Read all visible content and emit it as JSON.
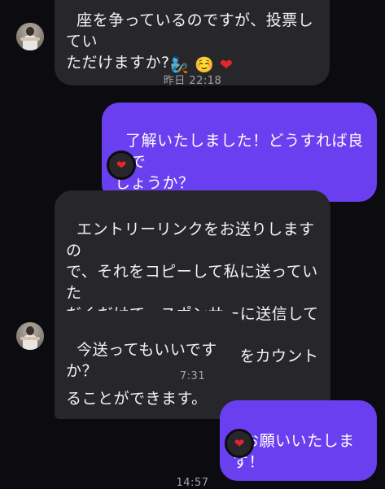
{
  "messages": [
    {
      "id": "m1",
      "type": "incoming",
      "text": "座を争っているのですが、投票してい\nただけますか?",
      "emoji": "🧞 ☺️ ",
      "heart": "❤"
    },
    {
      "id": "ts1",
      "type": "timestamp",
      "text": "昨日 22:18"
    },
    {
      "id": "m2",
      "type": "outgoing",
      "text": "了解いたしました！どうすれば良いで\nしょうか？",
      "reaction": "❤"
    },
    {
      "id": "m3",
      "type": "incoming",
      "text": "エントリーリンクをお送りしますの\nで、それをコピーして私に送っていた\nだくだけで、スポンサーに送信して私\nに代わってあなたの投票をカウントす\nることができます。"
    },
    {
      "id": "m4",
      "type": "incoming",
      "text": "今送ってもいいですか？"
    },
    {
      "id": "ts2",
      "type": "timestamp",
      "text": "7:31"
    },
    {
      "id": "m5",
      "type": "outgoing",
      "text": "お願いいたします！",
      "reaction": "❤"
    },
    {
      "id": "ts3",
      "type": "timestamp",
      "text": "14:57"
    }
  ],
  "colors": {
    "background": "#0b0b10",
    "incoming_bubble": "#26262b",
    "outgoing_bubble": "#6a3ff0",
    "timestamp_text": "#a2a2aa",
    "reaction_heart": "#e2262c"
  },
  "icons": {
    "avatar": "contact-avatar",
    "reaction": "red-heart-reaction"
  }
}
